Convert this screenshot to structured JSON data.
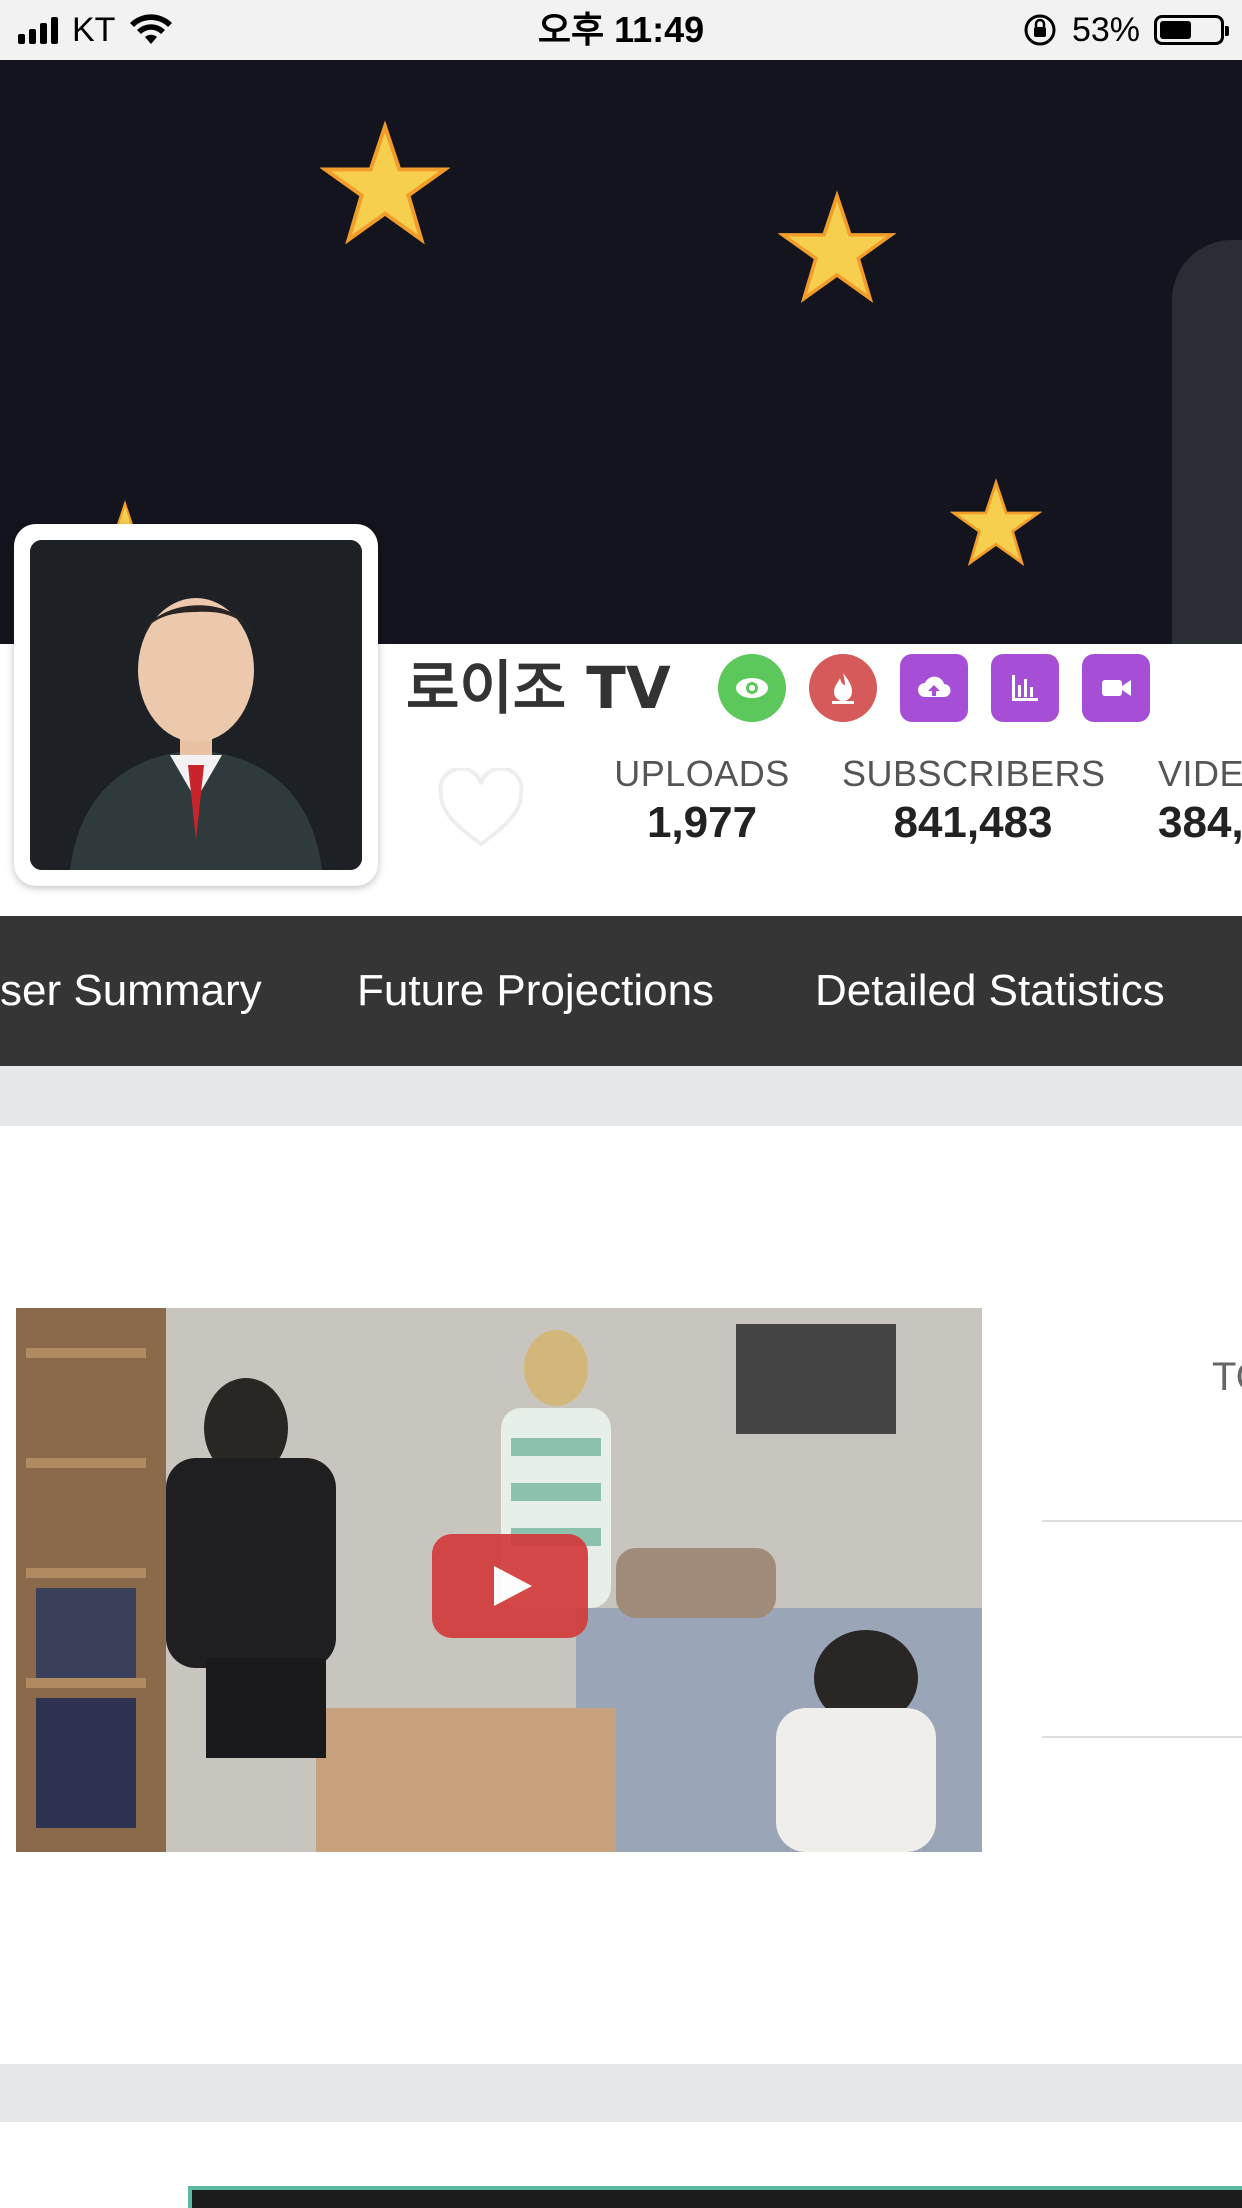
{
  "status_bar": {
    "carrier": "KT",
    "time": "오후 11:49",
    "battery_percent": "53%",
    "battery_level": 0.53
  },
  "channel": {
    "name": "로이조 TV",
    "badges": [
      {
        "icon": "eye-icon",
        "color": "#5cc85c"
      },
      {
        "icon": "flame-icon",
        "color": "#d65a5a"
      },
      {
        "icon": "cloud-upload-icon",
        "color": "#a64ed6"
      },
      {
        "icon": "bar-chart-icon",
        "color": "#a64ed6"
      },
      {
        "icon": "video-camera-icon",
        "color": "#a64ed6"
      }
    ],
    "stats": [
      {
        "label": "UPLOADS",
        "value": "1,977"
      },
      {
        "label": "SUBSCRIBERS",
        "value": "841,483"
      },
      {
        "label": "VIDE",
        "value": "384,"
      }
    ]
  },
  "nav": {
    "tabs": [
      "ser Summary",
      "Future Projections",
      "Detailed Statistics"
    ]
  },
  "content": {
    "side_label": "TO"
  },
  "colors": {
    "nav_bg": "#353535",
    "band": "#e5e8eb",
    "accent_purple": "#a64ed6"
  }
}
